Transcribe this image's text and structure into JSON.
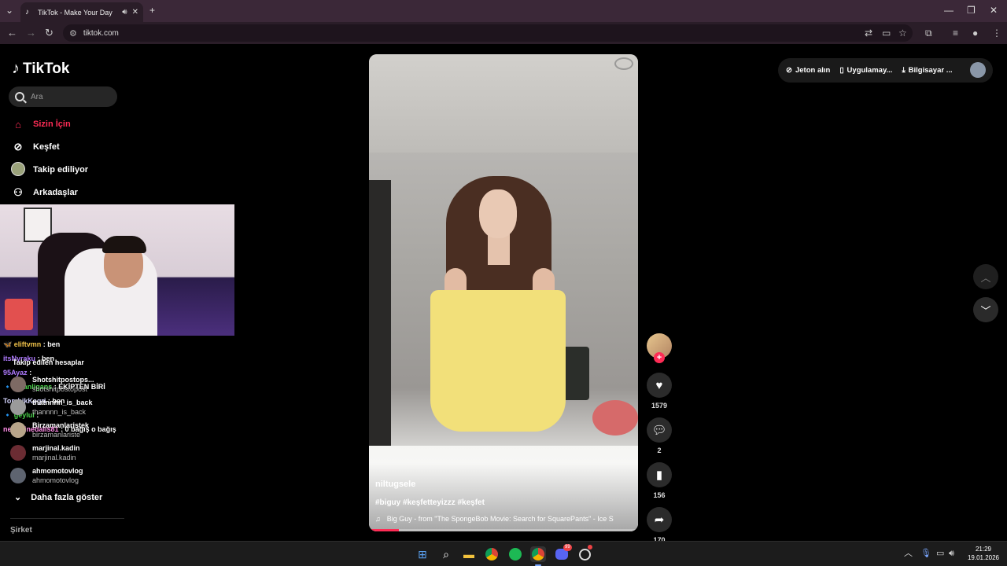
{
  "browser": {
    "tab_title": "TikTok - Make Your Day",
    "url": "tiktok.com"
  },
  "sidebar": {
    "logo": "TikTok",
    "search_placeholder": "Ara",
    "nav": [
      {
        "label": "Sizin İçin",
        "icon": "home-icon",
        "active": true
      },
      {
        "label": "Keşfet",
        "icon": "compass-icon"
      },
      {
        "label": "Takip ediliyor",
        "icon": "following-avatar-icon"
      },
      {
        "label": "Arkadaşlar",
        "icon": "friends-icon"
      }
    ],
    "following_title": "Takip edilen hesaplar",
    "following": [
      {
        "name": "Shotshitpostops...",
        "handle": "shotshitpostopost"
      },
      {
        "name": "thatnnnn_is_back",
        "handle": "thannnn_is_back"
      },
      {
        "name": "Birzamanlaristek",
        "handle": "birzamanlariste"
      },
      {
        "name": "marjinal.kadin",
        "handle": "marjinal.kadin"
      },
      {
        "name": "ahmomotovlog",
        "handle": "ahmomotovlog"
      }
    ],
    "more_label": "Daha fazla göster",
    "company_label": "Şirket"
  },
  "chat": [
    {
      "user": "eliftvmn",
      "msg": ": ben",
      "color": "#f0c24a",
      "badge": "🦋"
    },
    {
      "user": "itsNyraku",
      "msg": ": ben",
      "color": "#b07bff",
      "badge": ""
    },
    {
      "user": "95Ayaz",
      "msg": ":",
      "color": "#b07bff",
      "badge": ""
    },
    {
      "user": "Gilanligans",
      "msg": ": EKİPTEN BİRİ",
      "color": "#4bd24b",
      "badge": "🔹"
    },
    {
      "user": "TombikKegri",
      "msg": ": ben",
      "color": "#d6d6ff",
      "badge": ""
    },
    {
      "user": "geylul",
      "msg": ":",
      "color": "#4bd24b",
      "badge": "🔹"
    },
    {
      "user": "nesrininedalis81",
      "msg": ": 0 bağış o bağış",
      "color": "#ff8ce6",
      "badge": ""
    }
  ],
  "video": {
    "username": "niltugsele",
    "hashtags": "#biguy #keşfetteyizzz #keşfet",
    "music": "Big Guy - from \"The SpongeBob Movie: Search for SquarePants\" - Ice S",
    "progress": 0.11
  },
  "actions": {
    "likes": "1579",
    "comments": "2",
    "saves": "156",
    "shares": "170"
  },
  "topbar": {
    "coins": "Jeton alın",
    "app": "Uygulamay...",
    "desktop": "Bilgisayar ..."
  },
  "taskbar": {
    "time": "21:29",
    "date": "19.01.2026",
    "discord_badge": "99"
  },
  "colors": {
    "accent": "#fe2c55",
    "browser_frame": "#3b2838"
  }
}
